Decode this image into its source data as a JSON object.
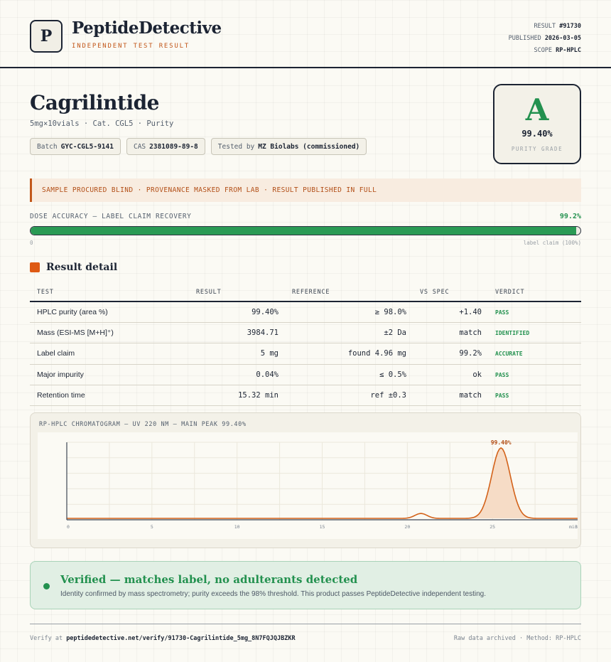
{
  "brand": {
    "logo_letter": "P",
    "name": "PeptideDetective",
    "subtitle": "INDEPENDENT TEST RESULT"
  },
  "meta": {
    "result_label": "RESULT",
    "result_value": "#91730",
    "published_label": "PUBLISHED",
    "published_value": "2026-03-05",
    "scope_label": "SCOPE",
    "scope_value": "RP-HPLC"
  },
  "product": {
    "name": "Cagrilintide",
    "subline": "5mg×10vials · Cat. CGL5 · Purity",
    "chips": {
      "batch_label": "Batch",
      "batch_value": "GYC-CGL5-9141",
      "cas_label": "CAS",
      "cas_value": "2381089-89-8",
      "tested_label": "Tested by",
      "tested_value": "MZ Biolabs (commissioned)"
    }
  },
  "grade": {
    "letter": "A",
    "value": "99.40%",
    "label": "PURITY GRADE"
  },
  "notice": "SAMPLE PROCURED BLIND · PROVENANCE MASKED FROM LAB · RESULT PUBLISHED IN FULL",
  "dose": {
    "label": "DOSE ACCURACY — LABEL CLAIM RECOVERY",
    "value": "99.2%",
    "fraction": 0.992,
    "min_label": "0",
    "max_label": "label claim (100%)"
  },
  "results": {
    "title": "Result detail",
    "headers": {
      "test": "TEST",
      "result": "RESULT",
      "reference": "REFERENCE",
      "vs_spec": "VS SPEC",
      "verdict": "VERDICT"
    },
    "rows": [
      {
        "test": "HPLC purity (area %)",
        "result": "99.40%",
        "reference": "≥ 98.0%",
        "vs_spec": "+1.40",
        "verdict": "PASS"
      },
      {
        "test": "Mass (ESI-MS [M+H]⁺)",
        "result": "3984.71",
        "reference": "±2 Da",
        "vs_spec": "match",
        "verdict": "IDENTIFIED"
      },
      {
        "test": "Label claim",
        "result": "5 mg",
        "reference": "found 4.96 mg",
        "vs_spec": "99.2%",
        "verdict": "ACCURATE"
      },
      {
        "test": "Major impurity",
        "result": "0.04%",
        "reference": "≤ 0.5%",
        "vs_spec": "ok",
        "verdict": "PASS"
      },
      {
        "test": "Retention time",
        "result": "15.32 min",
        "reference": "ref ±0.3",
        "vs_spec": "match",
        "verdict": "PASS"
      }
    ]
  },
  "chromatogram": {
    "title": "RP-HPLC CHROMATOGRAM — UV 220 NM — MAIN PEAK 99.40%",
    "peak_label": "99.40%",
    "x_unit": "min"
  },
  "chart_data": {
    "type": "line",
    "title": "RP-HPLC CHROMATOGRAM — UV 220 NM — MAIN PEAK 99.40%",
    "xlim": [
      0,
      30
    ],
    "x_ticks": [
      0,
      5,
      10,
      15,
      20,
      25,
      30
    ],
    "x_tick_labels": [
      "0",
      "5",
      "10",
      "15",
      "20",
      "25",
      "30",
      "min"
    ],
    "baseline": 0.02,
    "peaks": [
      {
        "center": 20.8,
        "height": 0.07,
        "width": 0.35
      },
      {
        "center": 25.5,
        "height": 1.0,
        "width": 0.55,
        "label": "99.40%"
      }
    ],
    "ylim": [
      0,
      1.1
    ],
    "grid": true,
    "colors": {
      "line": "#d3621a",
      "fill": "#f6dcc6"
    }
  },
  "verified": {
    "title": "Verified — matches label, no adulterants detected",
    "text": "Identity confirmed by mass spectrometry; purity exceeds the 98% threshold. This product passes PeptideDetective independent testing."
  },
  "footer": {
    "verify_label": "Verify at",
    "verify_url": "peptidedetective.net/verify/91730-Cagrilintide_5mg_8N7FQJQJBZKR",
    "right": "Raw data archived · Method: RP-HPLC"
  },
  "colors": {
    "accent": "#de5a14",
    "pass": "#23914f",
    "ink": "#1c2433"
  }
}
